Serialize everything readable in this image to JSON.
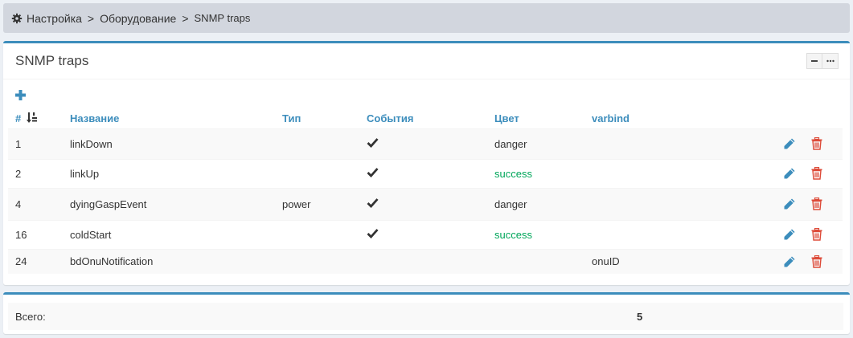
{
  "breadcrumb": {
    "items": [
      "Настройка",
      "Оборудование"
    ],
    "separator": ">",
    "active": "SNMP traps"
  },
  "panel": {
    "title": "SNMP traps"
  },
  "table": {
    "headers": {
      "id": "#",
      "name": "Название",
      "type": "Тип",
      "events": "События",
      "color": "Цвет",
      "varbind": "varbind"
    },
    "rows": [
      {
        "id": "1",
        "name": "linkDown",
        "type": "",
        "events": true,
        "color": "danger",
        "varbind": ""
      },
      {
        "id": "2",
        "name": "linkUp",
        "type": "",
        "events": true,
        "color": "success",
        "varbind": ""
      },
      {
        "id": "4",
        "name": "dyingGaspEvent",
        "type": "power",
        "events": true,
        "color": "danger",
        "varbind": ""
      },
      {
        "id": "16",
        "name": "coldStart",
        "type": "",
        "events": true,
        "color": "success",
        "varbind": ""
      },
      {
        "id": "24",
        "name": "bdOnuNotification",
        "type": "",
        "events": false,
        "color": "",
        "varbind": "onuID"
      }
    ]
  },
  "footer": {
    "total_label": "Всего:",
    "total_value": "5"
  },
  "icons": {
    "gear": "gear-icon",
    "add": "plus-icon",
    "sort": "sort-numeric-asc-icon",
    "check": "check-icon",
    "edit": "pencil-icon",
    "delete": "trash-icon",
    "collapse": "minus-icon",
    "more": "ellipsis-icon"
  },
  "colors": {
    "accent": "#3c8dbc",
    "success": "#00a65a",
    "delete": "#dd4b39"
  }
}
